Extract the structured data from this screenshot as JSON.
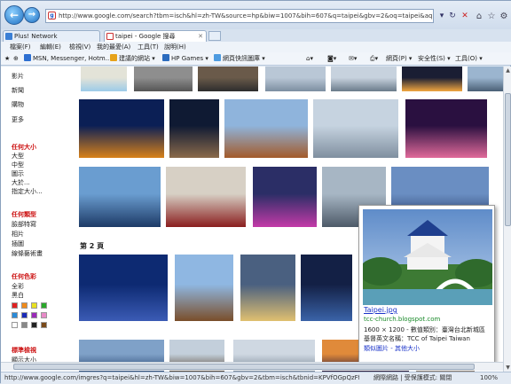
{
  "browser": {
    "url": "http://www.google.com/search?tbm=isch&hl=zh-TW&source=hp&biw=1007&bih=607&q=taipei&gbv=2&oq=taipei&aq=f&aqi=g",
    "tabs": [
      {
        "title": "Plus! Network",
        "icon_color": "#3a7fd5"
      },
      {
        "title": "taipei - Google 搜尋",
        "icon_color": "#3a7fd5"
      }
    ],
    "menu": [
      "檔案(F)",
      "編輯(E)",
      "檢視(V)",
      "我的最愛(A)",
      "工具(T)",
      "說明(H)"
    ],
    "favorites": [
      {
        "label": "MSN, Messenger, Hotm...",
        "color": "#2d6fd1"
      },
      {
        "label": "建議的網站 ▾",
        "color": "#e6a21a"
      },
      {
        "label": "HP Games ▾",
        "color": "#2c6cbf"
      },
      {
        "label": "網頁快訊圖庫 ▾",
        "color": "#4d9be0"
      }
    ],
    "command_bar": [
      "網頁(P) ▾",
      "安全性(S) ▾",
      "工具(O) ▾"
    ]
  },
  "sidebar": {
    "types": [
      "影片",
      "新聞",
      "購物",
      "更多"
    ],
    "size_heading": "任何大小",
    "sizes": [
      "大型",
      "中型",
      "圖示",
      "大於...",
      "指定大小..."
    ],
    "type_heading": "任何類型",
    "image_types": [
      "臉部特寫",
      "相片",
      "插圖",
      "線條藝術畫"
    ],
    "color_heading": "任何色彩",
    "colors_text": [
      "全彩",
      "黑白"
    ],
    "swatches": [
      "#e02020",
      "#f08a1a",
      "#e8e020",
      "#2aa82a",
      "#2a8ad8",
      "#1a2ab8",
      "#9a2ab8",
      "#e88ac8",
      "#ffffff",
      "#888888",
      "#222222",
      "#7a4a1a"
    ],
    "std_heading": "標準檢視",
    "std_opt": "顯示大小"
  },
  "results": {
    "page2_label": "第 2 頁"
  },
  "hover_card": {
    "title": "Taipei.jpg",
    "domain": "tcc-church.blogspot.com",
    "desc1": "1600 × 1200 - 數值類別：臺灣台北新城區",
    "desc2": "基督英文名稱：TCC of Taipei Taiwan",
    "links": "類似圖片 - 其他大小"
  },
  "status": {
    "text": "http://www.google.com/imgres?q=taipei&hl=zh-TW&biw=1007&bih=607&gbv=2&tbm=isch&tbnid=KPVfOGpQzFfQyM:&imgrefurl=http://tcc-church.blogsp",
    "zone": "網際網路 | 受保護模式: 關閉",
    "zoom": "100%"
  }
}
